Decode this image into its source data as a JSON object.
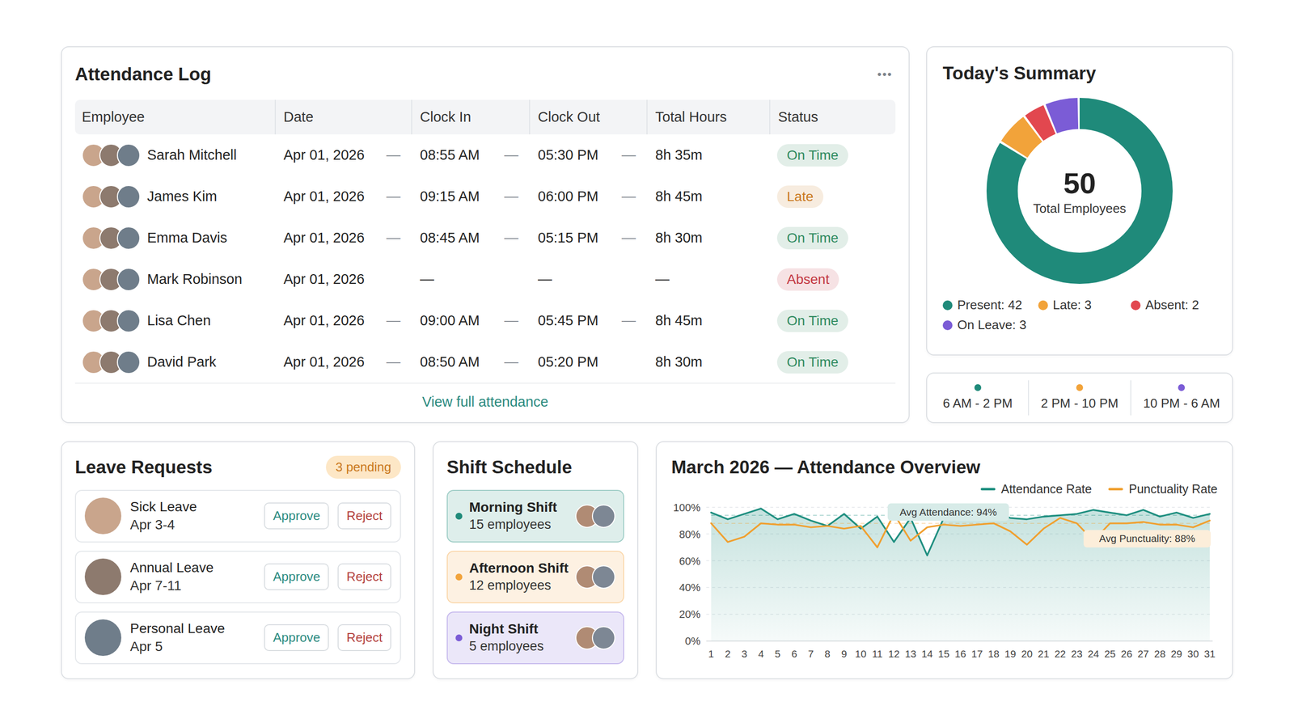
{
  "attendance_log": {
    "title": "Attendance Log",
    "menu_icon": "•••",
    "columns": [
      "Employee",
      "Date",
      "Clock In",
      "Clock Out",
      "Total Hours",
      "Status"
    ],
    "separator": "—",
    "rows": [
      {
        "employee": "Sarah Mitchell",
        "date": "Apr 01, 2026",
        "clock_in": "08:55 AM",
        "clock_out": "05:30 PM",
        "total_hours": "8h 35m",
        "status": "On Time",
        "status_color": "#2f8a5f",
        "dividers": [
          true,
          true,
          true
        ]
      },
      {
        "employee": "James Kim",
        "date": "Apr 01, 2026",
        "clock_in": "09:15 AM",
        "clock_out": "06:00 PM",
        "total_hours": "8h 45m",
        "status": "Late",
        "status_color": "#c9781d",
        "dividers": [
          true,
          true,
          true
        ]
      },
      {
        "employee": "Emma Davis",
        "date": "Apr 01, 2026",
        "clock_in": "08:45 AM",
        "clock_out": "05:15 PM",
        "total_hours": "8h 30m",
        "status": "On Time",
        "status_color": "#2f8a5f",
        "dividers": [
          true,
          true,
          true
        ]
      },
      {
        "employee": "Mark Robinson",
        "date": "Apr 01, 2026",
        "clock_in": "—",
        "clock_out": "—",
        "total_hours": "—",
        "status": "Absent",
        "status_color": "#c2353f",
        "dividers": [
          false,
          false,
          false
        ]
      },
      {
        "employee": "Lisa Chen",
        "date": "Apr 01, 2026",
        "clock_in": "09:00 AM",
        "clock_out": "05:45 PM",
        "total_hours": "8h 45m",
        "status": "On Time",
        "status_color": "#2f8a5f",
        "dividers": [
          true,
          true,
          true
        ]
      },
      {
        "employee": "David Park",
        "date": "Apr 01, 2026",
        "clock_in": "08:50 AM",
        "clock_out": "05:20 PM",
        "total_hours": "8h 30m",
        "status": "On Time",
        "status_color": "#2f8a5f",
        "dividers": [
          true,
          true,
          false
        ]
      }
    ],
    "footer_link": "View full attendance"
  },
  "todays_summary": {
    "title": "Today's Summary",
    "total": "50",
    "total_label": "Total Employees",
    "segments": [
      {
        "text": "Present: 42",
        "value": 42,
        "color": "#1f8a7a"
      },
      {
        "text": "Late: 3",
        "value": 3,
        "color": "#f2a33a"
      },
      {
        "text": "Absent: 2",
        "value": 2,
        "color": "#e2474f"
      },
      {
        "text": "On Leave: 3",
        "value": 3,
        "color": "#7b5cd6"
      }
    ]
  },
  "shift_legend": [
    {
      "text": "6 AM - 2 PM",
      "color": "#1f8a7a"
    },
    {
      "text": "2 PM - 10 PM",
      "color": "#f2a33a"
    },
    {
      "text": "10 PM - 6 AM",
      "color": "#7b5cd6"
    }
  ],
  "leave_requests": {
    "title": "Leave Requests",
    "badge": "3 pending",
    "items": [
      {
        "type": "Sick Leave",
        "dates": "Apr 3-4",
        "approve": "Approve",
        "reject": "Reject"
      },
      {
        "type": "Annual Leave",
        "dates": "Apr 7-11",
        "approve": "Approve",
        "reject": "Reject"
      },
      {
        "type": "Personal Leave",
        "dates": "Apr 5",
        "approve": "Approve",
        "reject": "Reject"
      }
    ]
  },
  "shift_schedule": {
    "title": "Shift Schedule",
    "shifts": [
      {
        "name": "Morning Shift",
        "count": "15 employees",
        "color": "#1f8a7a"
      },
      {
        "name": "Afternoon Shift",
        "count": "12 employees",
        "color": "#f2a33a"
      },
      {
        "name": "Night Shift",
        "count": "5 employees",
        "color": "#7b5cd6"
      }
    ]
  },
  "chart": {
    "title": "March 2026 — Attendance Overview",
    "y_ticks": [
      "100%",
      "80%",
      "60%",
      "40%",
      "20%",
      "0%"
    ],
    "x_labels": [
      "1",
      "2",
      "3",
      "4",
      "5",
      "6",
      "7",
      "8",
      "9",
      "10",
      "11",
      "12",
      "13",
      "14",
      "15",
      "16",
      "17",
      "18",
      "19",
      "20",
      "21",
      "22",
      "23",
      "24",
      "25",
      "26",
      "27",
      "28",
      "29",
      "30",
      "31"
    ],
    "series": [
      {
        "name": "Attendance Rate",
        "color": "#1f8f80",
        "area": true,
        "values": [
          96,
          91,
          95,
          99,
          91,
          95,
          90,
          86,
          95,
          84,
          93,
          74,
          92,
          64,
          92,
          95,
          98,
          96,
          92,
          91,
          93,
          94,
          95,
          98,
          96,
          94,
          98,
          93,
          96,
          92,
          95
        ]
      },
      {
        "name": "Punctuality Rate",
        "color": "#f0a030",
        "area": false,
        "values": [
          88,
          74,
          78,
          88,
          87,
          87,
          85,
          86,
          84,
          86,
          70,
          95,
          75,
          85,
          87,
          86,
          87,
          88,
          82,
          72,
          84,
          92,
          88,
          75,
          88,
          88,
          89,
          87,
          87,
          85,
          90
        ]
      }
    ],
    "annotations": [
      {
        "text": "Avg Attendance: 94%",
        "value": 94,
        "color": "#1f8f80"
      },
      {
        "text": "Avg Punctuality: 88%",
        "value": 88,
        "color": "#f0a030"
      }
    ]
  }
}
